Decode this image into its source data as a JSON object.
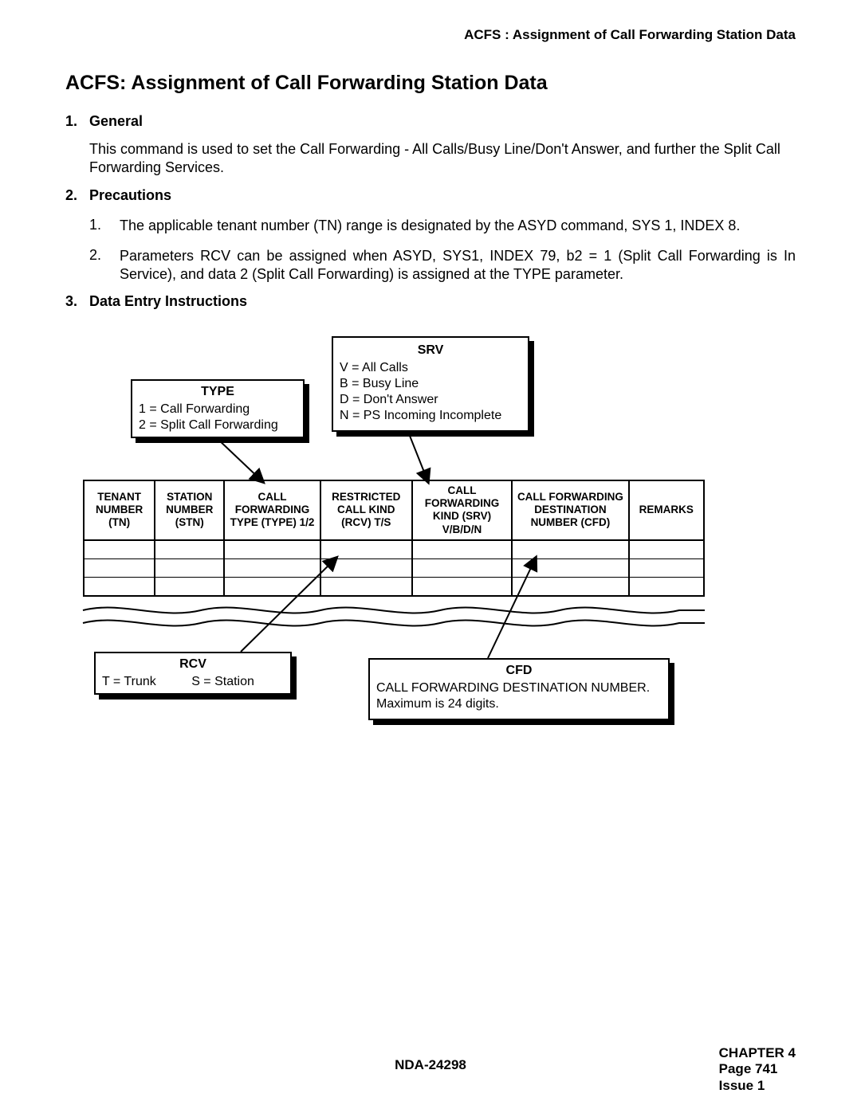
{
  "running_head": "ACFS : Assignment of Call Forwarding Station Data",
  "title": "ACFS: Assignment of Call Forwarding Station Data",
  "sections": {
    "s1": {
      "num": "1.",
      "label": "General",
      "body": "This command is used to set the Call Forwarding - All Calls/Busy Line/Don't Answer, and further the Split Call Forwarding Services."
    },
    "s2": {
      "num": "2.",
      "label": "Precautions",
      "items": {
        "i1": {
          "num": "1.",
          "text": "The applicable tenant number (TN) range is designated by the ASYD command, SYS 1, INDEX 8."
        },
        "i2": {
          "num": "2.",
          "text": "Parameters RCV can be assigned when ASYD, SYS1, INDEX 79, b2 = 1 (Split Call Forwarding is In Service), and data 2 (Split Call Forwarding) is assigned at the TYPE parameter."
        }
      }
    },
    "s3": {
      "num": "3.",
      "label": "Data Entry Instructions"
    }
  },
  "callouts": {
    "type": {
      "title": "TYPE",
      "line1": "1 = Call Forwarding",
      "line2": "2 = Split Call Forwarding"
    },
    "srv": {
      "title": "SRV",
      "line1": "V = All Calls",
      "line2": "B = Busy Line",
      "line3": "D = Don't Answer",
      "line4": "N = PS Incoming Incomplete"
    },
    "rcv": {
      "title": "RCV",
      "line1": "T = Trunk          S = Station"
    },
    "cfd": {
      "title": "CFD",
      "line1": "CALL FORWARDING DESTINATION NUMBER.",
      "line2": "Maximum is 24 digits."
    }
  },
  "table": {
    "h1": "TENANT NUMBER (TN)",
    "h2": "STATION NUMBER (STN)",
    "h3": "CALL FORWARDING TYPE (TYPE) 1/2",
    "h4": "RESTRICTED CALL KIND (RCV) T/S",
    "h5": "CALL FORWARDING KIND (SRV) V/B/D/N",
    "h6": "CALL FORWARDING DESTINATION NUMBER (CFD)",
    "h7": "REMARKS"
  },
  "footer": {
    "doc_id": "NDA-24298",
    "chapter": "CHAPTER 4",
    "page": "Page 741",
    "issue": "Issue 1"
  }
}
